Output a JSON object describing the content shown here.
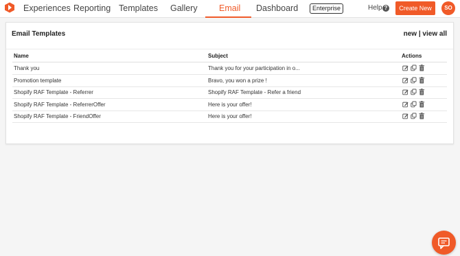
{
  "nav": {
    "items": [
      "Experiences",
      "Reporting",
      "Templates",
      "Gallery",
      "Email",
      "Dashboard"
    ],
    "active": "Email",
    "enterprise_label": "Enterprise",
    "help_label": "Help",
    "help_icon_glyph": "?",
    "create_new_label": "Create New",
    "avatar_initials": "SO"
  },
  "card": {
    "title": "Email Templates",
    "link_new": "new",
    "link_separator": "|",
    "link_view_all": "view all",
    "columns": [
      "Name",
      "Subject",
      "Actions"
    ],
    "rows": [
      {
        "name": "Thank you",
        "subject": "Thank you for your participation in o..."
      },
      {
        "name": "Promotion template",
        "subject": "Bravo, you won a prize !"
      },
      {
        "name": "Shopify RAF Template - Referrer",
        "subject": "Shopify RAF Template - Refer a friend"
      },
      {
        "name": "Shopify RAF Template - ReferrerOffer",
        "subject": "Here is your offer!"
      },
      {
        "name": "Shopify RAF Template - FriendOffer",
        "subject": "Here is your offer!"
      }
    ],
    "row_actions": [
      "edit-icon",
      "copy-icon",
      "trash-icon"
    ]
  },
  "colors": {
    "accent": "#f05a28",
    "background": "#f5f5f5"
  }
}
